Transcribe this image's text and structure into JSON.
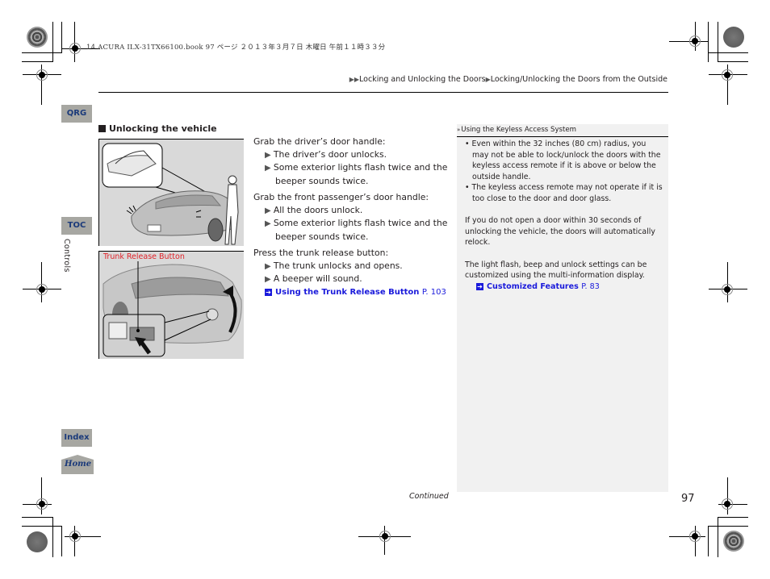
{
  "print_info": "14 ACURA ILX-31TX66100.book  97 ページ  ２０１３年３月７日  木曜日  午前１１時３３分",
  "breadcrumb": {
    "prefix_icon": "double-triangle",
    "items": [
      "Locking and Unlocking the Doors",
      "Locking/Unlocking the Doors from the Outside"
    ]
  },
  "side_tabs": {
    "qrg": "QRG",
    "toc": "TOC",
    "chapter": "Controls",
    "index": "Index",
    "home": "Home"
  },
  "section": {
    "title": "Unlocking the vehicle",
    "figure2_caption": "Trunk Release Button",
    "steps": [
      {
        "instruction": "Grab the driver’s door handle:",
        "results": [
          "The driver’s door unlocks.",
          "Some exterior lights flash twice and the beeper sounds twice."
        ]
      },
      {
        "instruction": "Grab the front passenger’s door handle:",
        "results": [
          "All the doors unlock.",
          "Some exterior lights flash twice and the beeper sounds twice."
        ]
      },
      {
        "instruction": "Press the trunk release button:",
        "results": [
          "The trunk unlocks and opens.",
          "A beeper will sound."
        ],
        "link": {
          "label": "Using the Trunk Release Button",
          "page": "P. 103"
        }
      }
    ]
  },
  "note": {
    "title": "Using the Keyless Access System",
    "bullets": [
      "Even within the 32 inches (80 cm) radius, you may not be able to lock/unlock the doors with the keyless access remote if it is above or below the outside handle.",
      "The keyless access remote may not operate if it is too close to the door and door glass."
    ],
    "para1": "If you do not open a door within 30 seconds of unlocking the vehicle, the doors will automatically relock.",
    "para2": "The light flash, beep and unlock settings can be customized using the multi-information display.",
    "link": {
      "label": "Customized Features",
      "page": "P. 83"
    }
  },
  "footer": {
    "continued": "Continued",
    "page_number": "97"
  },
  "colors": {
    "tab_bg": "#a7a7a2",
    "tab_text": "#1b3a7a",
    "link": "#1a1adb",
    "caption_red": "#e2232a",
    "note_bg": "#f1f1f1"
  }
}
